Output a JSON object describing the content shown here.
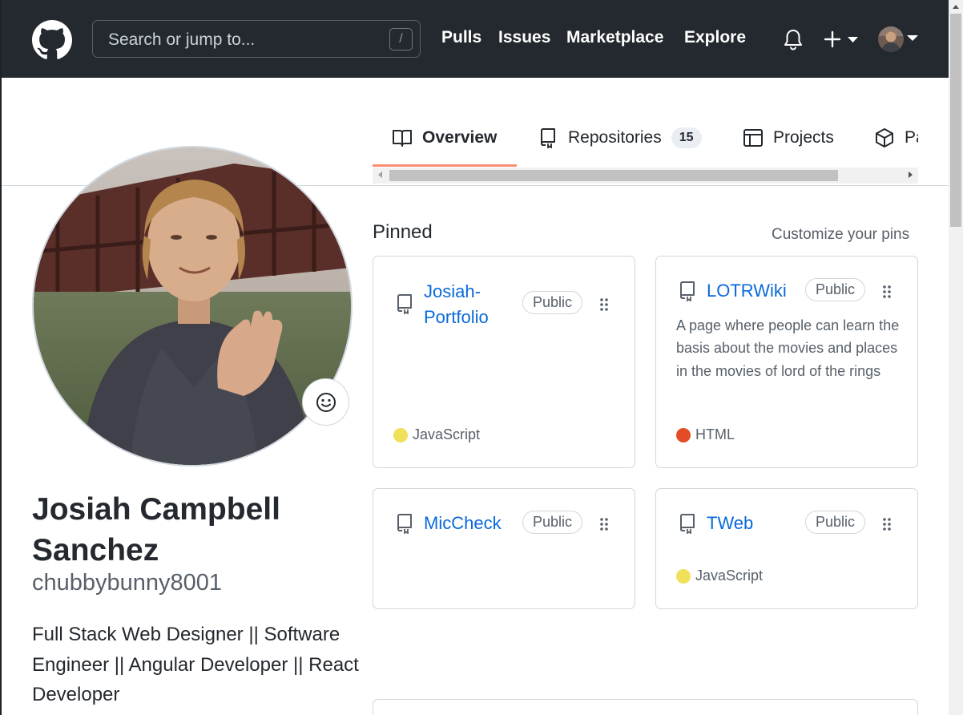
{
  "header": {
    "search_placeholder": "Search or jump to...",
    "search_shortcut": "/",
    "nav": [
      "Pulls",
      "Issues",
      "Marketplace",
      "Explore"
    ],
    "icons": [
      "github-logo-icon",
      "bell-icon",
      "plus-icon",
      "chevron-down-icon"
    ]
  },
  "tabs": [
    {
      "label": "Overview",
      "icon": "book-icon",
      "active": true
    },
    {
      "label": "Repositories",
      "icon": "repo-icon",
      "count": "15"
    },
    {
      "label": "Projects",
      "icon": "table-icon"
    },
    {
      "label": "Pa",
      "icon": "package-icon"
    }
  ],
  "profile": {
    "name": "Josiah Campbell Sanchez",
    "username": "chubbybunny8001",
    "bio": "Full Stack Web Designer || Software Engineer || Angular Developer || React Developer"
  },
  "pinned": {
    "title": "Pinned",
    "customize": "Customize your pins",
    "repos": [
      {
        "name": "Josiah-Portfolio",
        "visibility": "Public",
        "description": "",
        "language": "JavaScript",
        "language_color": "#f1e05a"
      },
      {
        "name": "LOTRWiki",
        "visibility": "Public",
        "description": "A page where people can learn the basis about the movies and places in the movies of lord of the rings",
        "language": "HTML",
        "language_color": "#e34c26"
      },
      {
        "name": "MicCheck",
        "visibility": "Public",
        "description": "",
        "language": "",
        "language_color": ""
      },
      {
        "name": "TWeb",
        "visibility": "Public",
        "description": "",
        "language": "JavaScript",
        "language_color": "#f1e05a"
      }
    ]
  },
  "colors": {
    "header_bg": "#24292f",
    "link": "#0969da",
    "tab_underline": "#fd8c73"
  }
}
